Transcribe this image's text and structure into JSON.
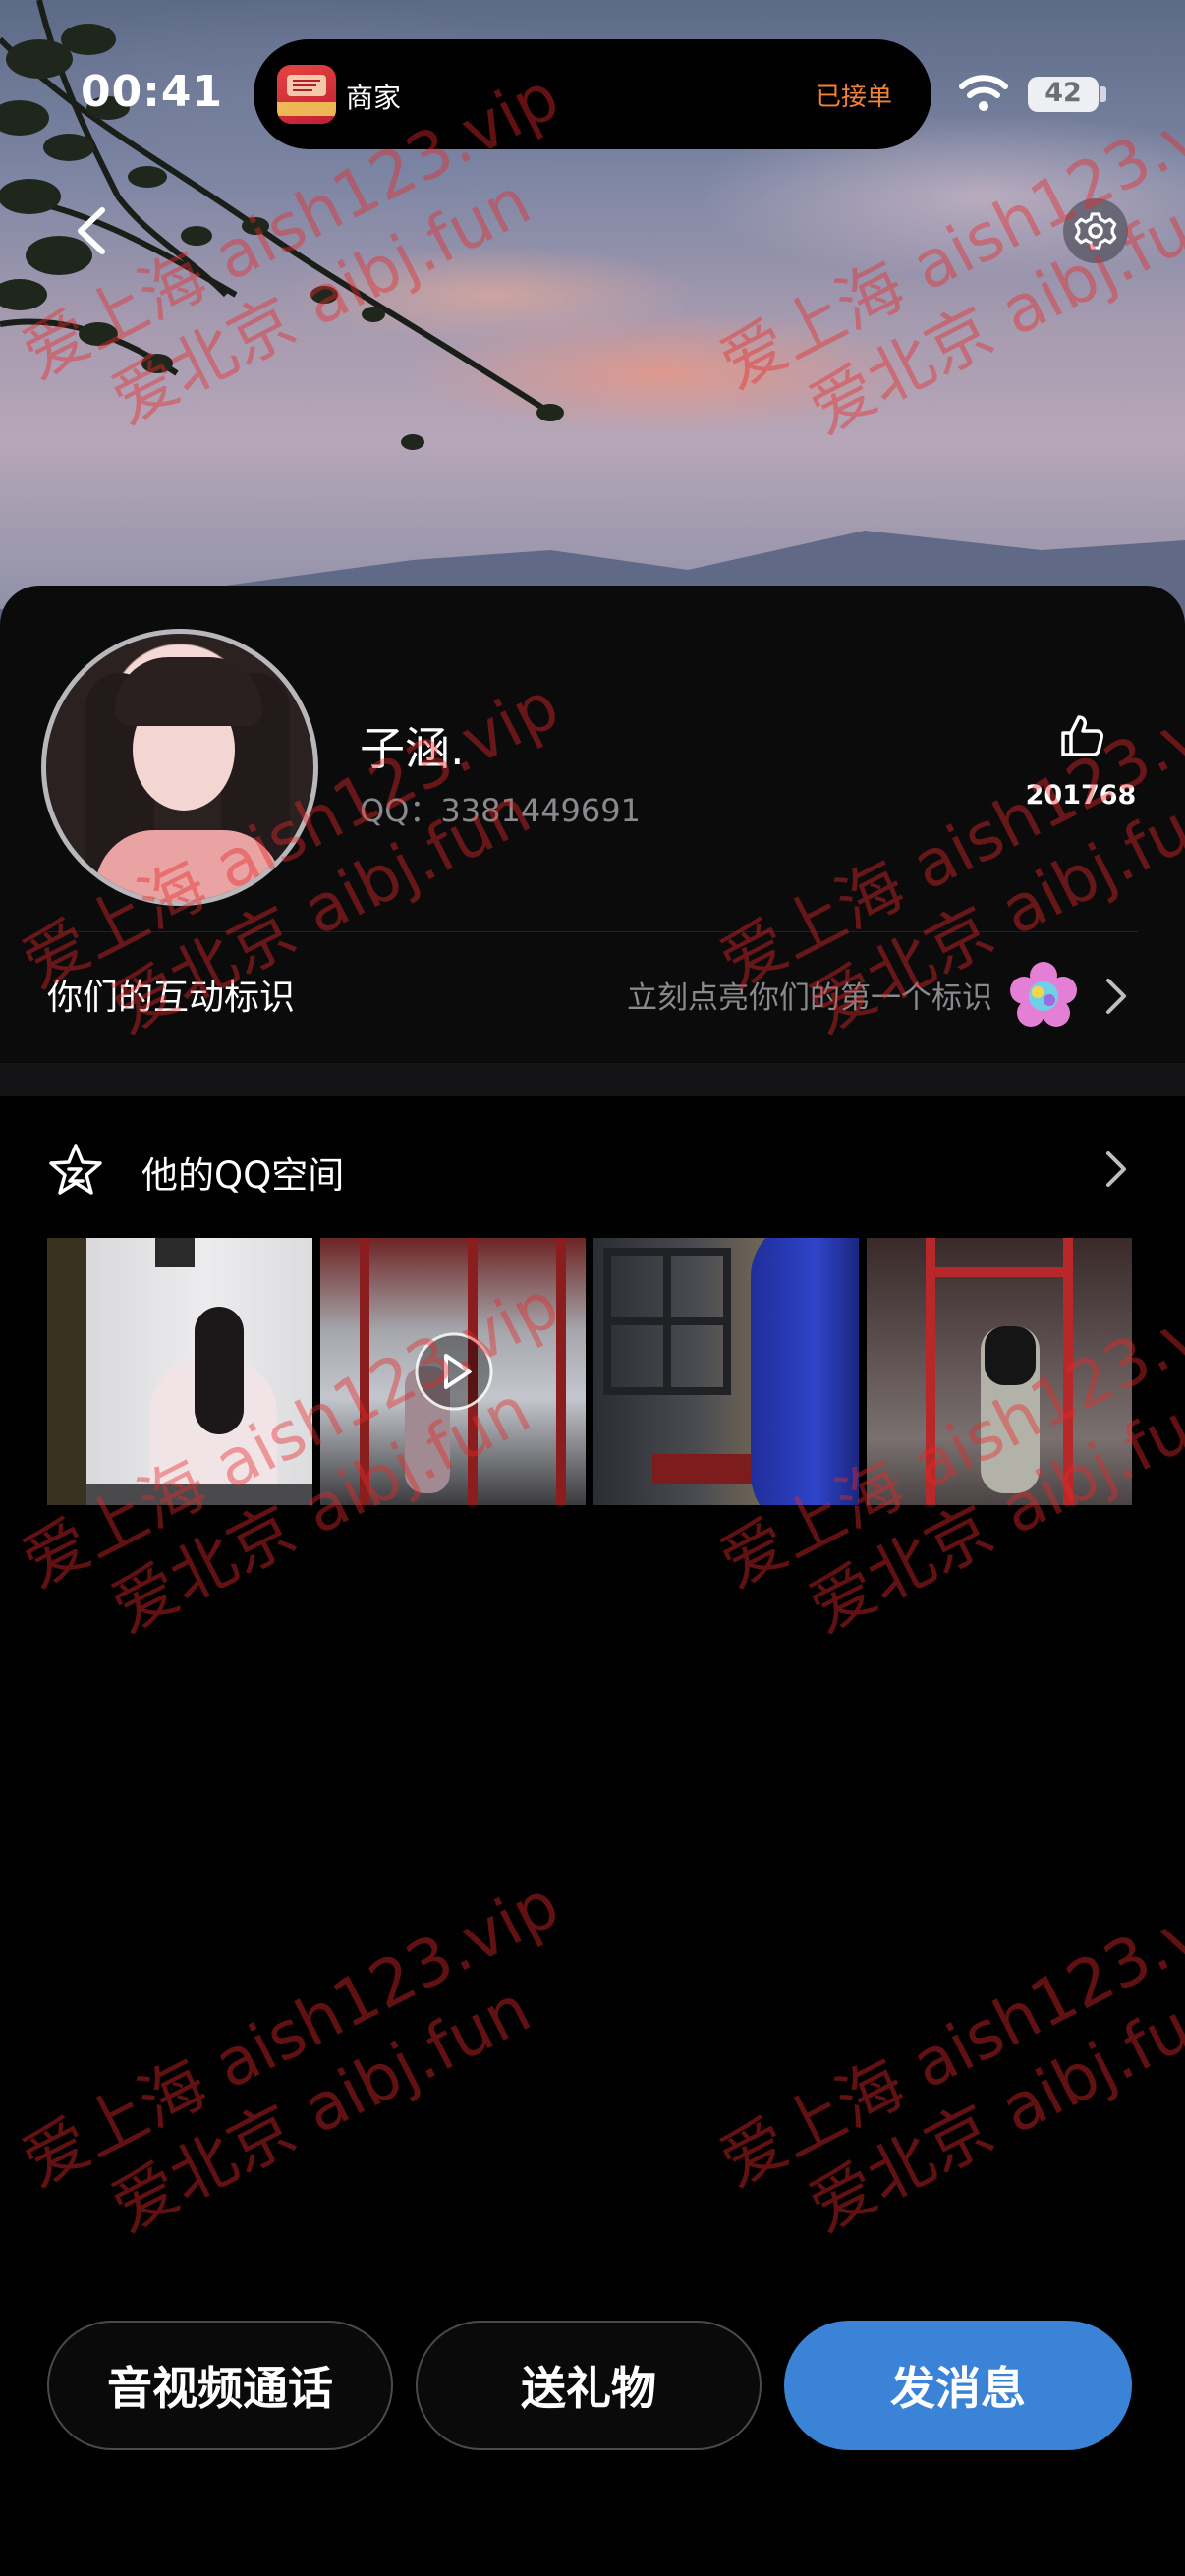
{
  "status_bar": {
    "time": "00:41",
    "island_app_name": "商家",
    "island_status": "已接单",
    "battery": "42"
  },
  "profile": {
    "nickname": "子涵.",
    "qq_label": "QQ：",
    "qq_number": "3381449691",
    "like_count": "201768"
  },
  "interaction": {
    "title": "你们的互动标识",
    "hint": "立刻点亮你们的第一个标识"
  },
  "qzone": {
    "title": "他的QQ空间"
  },
  "actions": {
    "call": "音视频通话",
    "gift": "送礼物",
    "message": "发消息"
  },
  "watermark": {
    "line1": "爱上海 aish123.vip",
    "line2": "爱北京 aibj.fun"
  },
  "colors": {
    "accent_blue": "#3b83d6",
    "island_status": "#f0823a",
    "background": "#000000"
  }
}
